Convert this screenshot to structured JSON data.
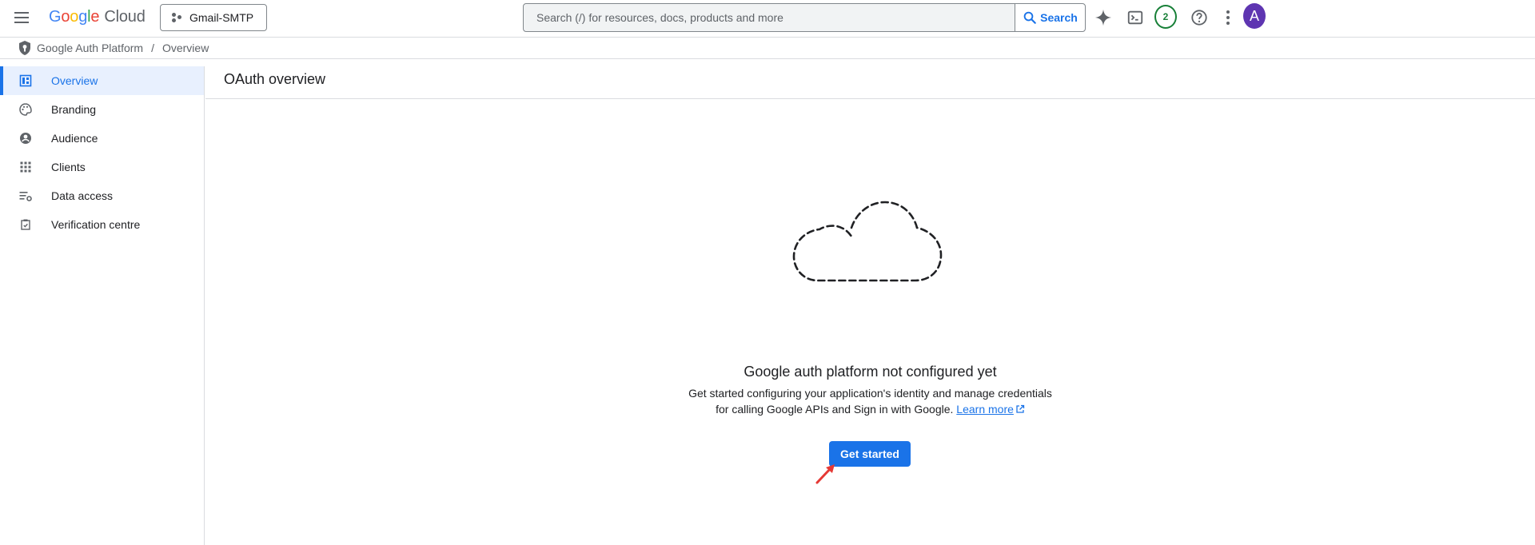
{
  "header": {
    "logo": {
      "g1": "G",
      "o1": "o",
      "o2": "o",
      "g2": "g",
      "l": "l",
      "e": "e",
      "cloud": "Cloud"
    },
    "project": "Gmail-SMTP",
    "search": {
      "placeholder": "Search (/) for resources, docs, products and more",
      "button_label": "Search"
    },
    "notifications_count": "2",
    "avatar_initial": "A"
  },
  "breadcrumb": {
    "parent": "Google Auth Platform",
    "current": "Overview"
  },
  "sidebar": {
    "items": [
      {
        "label": "Overview",
        "icon": "dashboard-icon",
        "active": true
      },
      {
        "label": "Branding",
        "icon": "palette-icon"
      },
      {
        "label": "Audience",
        "icon": "account-circle-icon"
      },
      {
        "label": "Clients",
        "icon": "apps-grid-icon"
      },
      {
        "label": "Data access",
        "icon": "data-settings-icon"
      },
      {
        "label": "Verification centre",
        "icon": "verification-icon"
      }
    ]
  },
  "main": {
    "title": "OAuth overview",
    "empty_state": {
      "title": "Google auth platform not configured yet",
      "line1": "Get started configuring your application's identity and manage credentials",
      "line2": "for calling Google APIs and Sign in with Google.",
      "learn_more": "Learn more",
      "button": "Get started"
    }
  },
  "colors": {
    "accent": "#1a73e8",
    "active_bg": "#e8f0fe",
    "badge": "#188038",
    "avatar": "#5e35b1",
    "annotation_arrow": "#e53935"
  }
}
